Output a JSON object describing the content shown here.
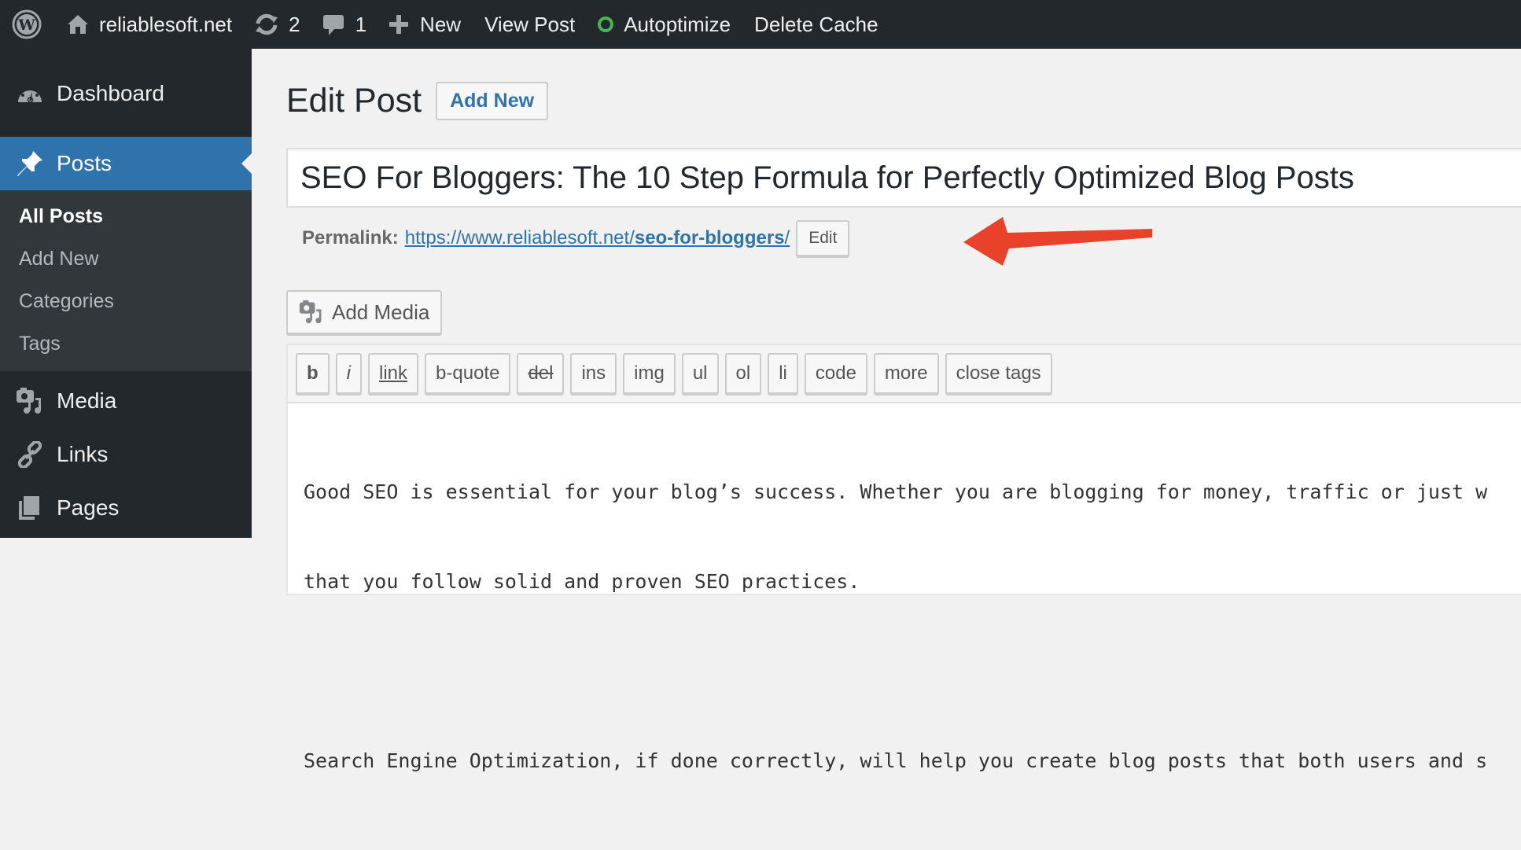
{
  "adminbar": {
    "site_name": "reliablesoft.net",
    "updates_count": "2",
    "comments_count": "1",
    "new_label": "New",
    "view_post_label": "View Post",
    "autoptimize_label": "Autoptimize",
    "autoptimize_status_color": "#46b450",
    "delete_cache_label": "Delete Cache"
  },
  "sidebar": {
    "items": [
      {
        "label": "Dashboard",
        "icon": "dashboard-icon"
      },
      {
        "label": "Posts",
        "icon": "pin-icon",
        "active": true
      },
      {
        "label": "Media",
        "icon": "media-icon"
      },
      {
        "label": "Links",
        "icon": "link-icon"
      },
      {
        "label": "Pages",
        "icon": "pages-icon"
      }
    ],
    "posts_submenu": [
      {
        "label": "All Posts",
        "current": true
      },
      {
        "label": "Add New"
      },
      {
        "label": "Categories"
      },
      {
        "label": "Tags"
      }
    ]
  },
  "main": {
    "page_title": "Edit Post",
    "add_new_label": "Add New",
    "post_title": "SEO For Bloggers: The 10 Step Formula for Perfectly Optimized Blog Posts",
    "permalink_label": "Permalink:",
    "permalink_base": "https://www.reliablesoft.net/",
    "permalink_slug": "seo-for-bloggers",
    "permalink_trailing": "/",
    "edit_slug_label": "Edit",
    "add_media_label": "Add Media",
    "quicktags": [
      "b",
      "i",
      "link",
      "b-quote",
      "del",
      "ins",
      "img",
      "ul",
      "ol",
      "li",
      "code",
      "more",
      "close tags"
    ],
    "content_lines": [
      "Good SEO is essential for your blog’s success. Whether you are blogging for money, traffic or just w",
      "that you follow solid and proven SEO practices.",
      "",
      "Search Engine Optimization, if done correctly, will help you create blog posts that both users and s"
    ]
  },
  "colors": {
    "adminbar_bg": "#23282d",
    "accent": "#2e73ac",
    "annotation_arrow": "#e8432a"
  }
}
